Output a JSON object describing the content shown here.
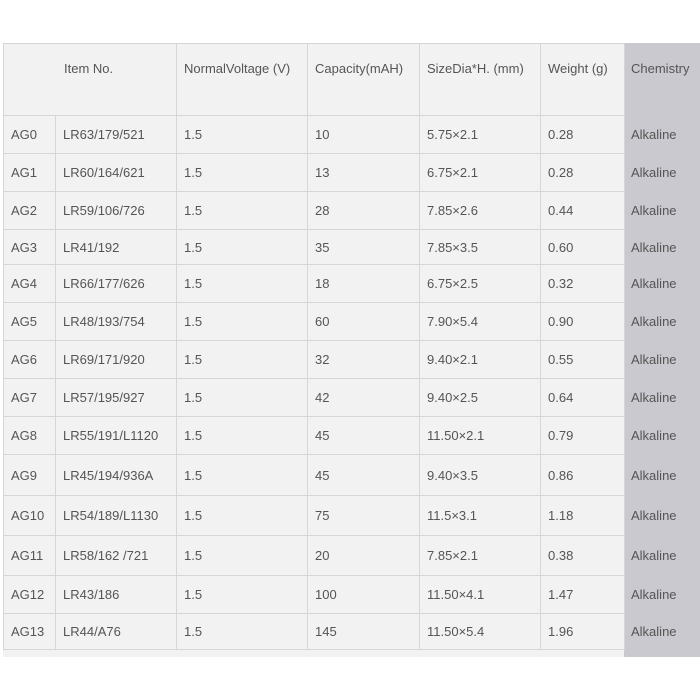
{
  "table": {
    "headers": {
      "model": "",
      "item_no": "Item No.",
      "voltage": "NormalVoltage (V)",
      "capacity": "Capacity(mAH)",
      "size": "SizeDia*H. (mm)",
      "weight": "Weight (g)",
      "chemistry": "Chemistry"
    },
    "rows": [
      {
        "model": "AG0",
        "item_no": "LR63/179/521",
        "voltage": "1.5",
        "capacity": "10",
        "size": "5.75×2.1",
        "weight": "0.28",
        "chemistry": "Alkaline"
      },
      {
        "model": "AG1",
        "item_no": "LR60/164/621",
        "voltage": "1.5",
        "capacity": "13",
        "size": "6.75×2.1",
        "weight": "0.28",
        "chemistry": "Alkaline"
      },
      {
        "model": "AG2",
        "item_no": "LR59/106/726",
        "voltage": "1.5",
        "capacity": "28",
        "size": "7.85×2.6",
        "weight": "0.44",
        "chemistry": "Alkaline"
      },
      {
        "model": "AG3",
        "item_no": "LR41/192",
        "voltage": "1.5",
        "capacity": "35",
        "size": "7.85×3.5",
        "weight": "0.60",
        "chemistry": "Alkaline"
      },
      {
        "model": "AG4",
        "item_no": "LR66/177/626",
        "voltage": "1.5",
        "capacity": "18",
        "size": "6.75×2.5",
        "weight": "0.32",
        "chemistry": "Alkaline"
      },
      {
        "model": "AG5",
        "item_no": "LR48/193/754",
        "voltage": "1.5",
        "capacity": "60",
        "size": "7.90×5.4",
        "weight": "0.90",
        "chemistry": "Alkaline"
      },
      {
        "model": "AG6",
        "item_no": "LR69/171/920",
        "voltage": "1.5",
        "capacity": "32",
        "size": "9.40×2.1",
        "weight": "0.55",
        "chemistry": "Alkaline"
      },
      {
        "model": "AG7",
        "item_no": "LR57/195/927",
        "voltage": "1.5",
        "capacity": "42",
        "size": "9.40×2.5",
        "weight": "0.64",
        "chemistry": "Alkaline"
      },
      {
        "model": "AG8",
        "item_no": "LR55/191/L1120",
        "voltage": "1.5",
        "capacity": "45",
        "size": "11.50×2.1",
        "weight": "0.79",
        "chemistry": "Alkaline"
      },
      {
        "model": "AG9",
        "item_no": "LR45/194/936A",
        "voltage": "1.5",
        "capacity": "45",
        "size": "9.40×3.5",
        "weight": "0.86",
        "chemistry": "Alkaline"
      },
      {
        "model": "AG10",
        "item_no": "LR54/189/L1130",
        "voltage": "1.5",
        "capacity": "75",
        "size": "11.5×3.1",
        "weight": "1.18",
        "chemistry": "Alkaline"
      },
      {
        "model": "AG11",
        "item_no": "LR58/162 /721",
        "voltage": "1.5",
        "capacity": "20",
        "size": "7.85×2.1",
        "weight": "0.38",
        "chemistry": "Alkaline"
      },
      {
        "model": "AG12",
        "item_no": "LR43/186",
        "voltage": "1.5",
        "capacity": "100",
        "size": "11.50×4.1",
        "weight": "1.47",
        "chemistry": "Alkaline"
      },
      {
        "model": "AG13",
        "item_no": "LR44/A76",
        "voltage": "1.5",
        "capacity": "145",
        "size": "11.50×5.4",
        "weight": "1.96",
        "chemistry": "Alkaline"
      }
    ]
  }
}
